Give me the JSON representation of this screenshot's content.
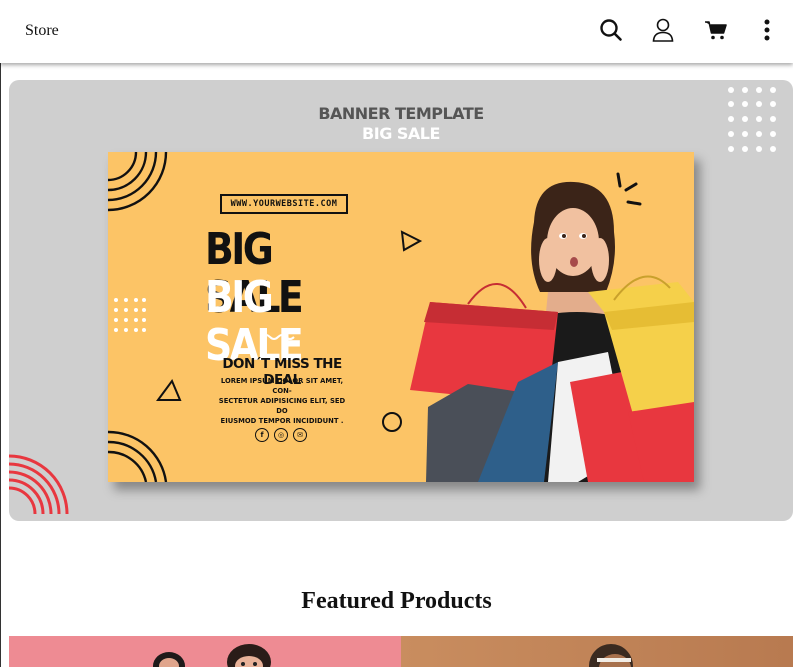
{
  "header": {
    "brand": "Store",
    "icons": [
      "search-icon",
      "user-icon",
      "cart-icon",
      "more-vertical-icon"
    ]
  },
  "hero": {
    "banner_template_label": "BANNER TEMPLATE",
    "big_sale_label": "BIG SALE",
    "website": "WWW.YOURWEBSITE.COM",
    "headline_line1": "BIG SALE",
    "headline_line2": "BIG SALE",
    "deal": "DON´T MISS THE DEAL",
    "body_line1": "LOREM IPSUM DOLOR SIT AMET, CON-",
    "body_line2": "SECTETUR ADIPISICING ELIT, SED DO",
    "body_line3": "EIUSMOD TEMPOR INCIDIDUNT .",
    "social_icons": [
      "facebook-icon",
      "instagram-icon",
      "mail-icon"
    ],
    "colors": {
      "background": "#cfcfcf",
      "banner": "#fcc466",
      "accent_red": "#e8373f"
    }
  },
  "featured": {
    "title": "Featured Products",
    "products": [
      "product-card-1",
      "product-card-2"
    ]
  }
}
